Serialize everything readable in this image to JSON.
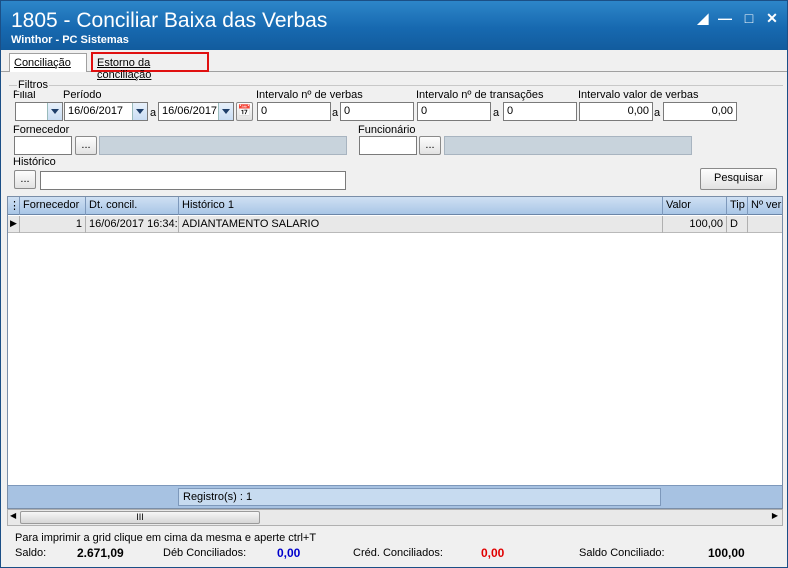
{
  "window": {
    "title": "1805 - Conciliar Baixa das Verbas",
    "subtitle": "Winthor - PC Sistemas",
    "controls": [
      "restore-icon",
      "minimize-icon",
      "maximize-icon",
      "close-icon"
    ]
  },
  "tabs": [
    {
      "label": "Conciliação"
    },
    {
      "label": "Estorno da conciliação"
    }
  ],
  "filters": {
    "group_label": "Filtros",
    "filial_label": "Filial",
    "filial_value": "",
    "periodo_label": "Período",
    "periodo_start": "16/06/2017",
    "a1": "a",
    "periodo_end": "16/06/2017",
    "verbas_label": "Intervalo nº de verbas",
    "verbas_from": "0",
    "a2": "a",
    "verbas_to": "0",
    "transacoes_label": "Intervalo nº de transações",
    "transacoes_from": "0",
    "a3": "a",
    "transacoes_to": "0",
    "valor_label": "Intervalo valor de verbas",
    "valor_from": "0,00",
    "a4": "a",
    "valor_to": "0,00",
    "fornecedor_label": "Fornecedor",
    "funcionario_label": "Funcionário",
    "historico_label": "Histórico",
    "ellipsis": "...",
    "search_label": "Pesquisar"
  },
  "grid": {
    "columns": [
      "Fornecedor",
      "Dt. concil.",
      "Histórico 1",
      "Valor",
      "Tip",
      "Nº ver"
    ],
    "rows": [
      {
        "fornecedor": "1",
        "dt": "16/06/2017 16:34:",
        "historico": "ADIANTAMENTO SALARIO",
        "valor": "100,00",
        "tip": "D",
        "nver": ""
      }
    ],
    "footer": "Registro(s) : 1",
    "scroll_thumb": "III"
  },
  "status": {
    "hint": "Para imprimir a grid  clique em cima da mesma e aperte ctrl+T",
    "saldo_label": "Saldo:",
    "saldo_value": "2.671,09",
    "deb_label": "Déb Conciliados:",
    "deb_value": "0,00",
    "cred_label": "Créd. Conciliados:",
    "cred_value": "0,00",
    "saldo_conc_label": "Saldo Conciliado:",
    "saldo_conc_value": "100,00"
  },
  "colors": {
    "deb": "#0000cc",
    "cred": "#e00000",
    "titlebar": "#1769b0"
  }
}
